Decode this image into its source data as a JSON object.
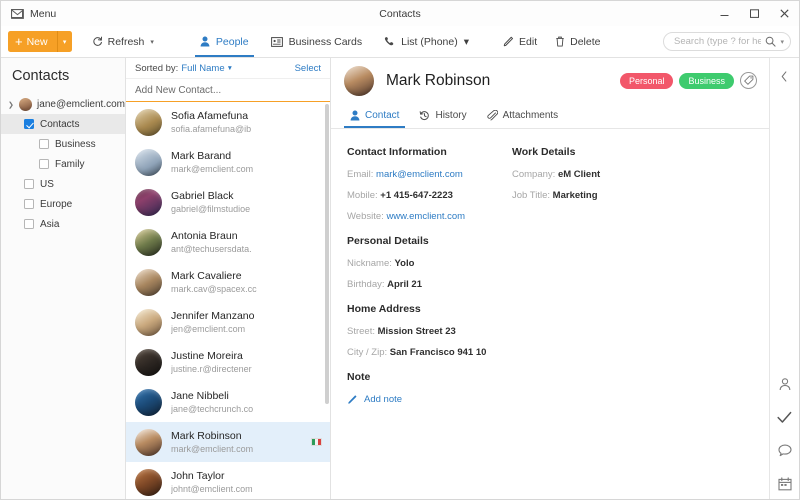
{
  "titlebar": {
    "menu_label": "Menu",
    "menu_icon": "envelope-icon",
    "window_title": "Contacts",
    "minimize_icon": "minimize-icon",
    "maximize_icon": "maximize-icon",
    "close_icon": "close-icon"
  },
  "toolbar": {
    "new_label": "New",
    "new_color": "#f6a026",
    "refresh_label": "Refresh",
    "tabs": [
      {
        "label": "People",
        "icon": "person-icon",
        "active": true
      },
      {
        "label": "Business Cards",
        "icon": "card-icon",
        "active": false
      },
      {
        "label": "List (Phone)",
        "icon": "phone-icon",
        "active": false,
        "has_caret": true
      }
    ],
    "edit_label": "Edit",
    "delete_label": "Delete",
    "accent": "#2e7cc4"
  },
  "search": {
    "placeholder": "Search (type ? for help)",
    "value": "",
    "icon": "search-icon"
  },
  "sidebar": {
    "title": "Contacts",
    "account": "jane@emclient.com",
    "items": [
      {
        "label": "Contacts",
        "checked": true,
        "level": 1,
        "selected": true
      },
      {
        "label": "Business",
        "checked": false,
        "level": 2,
        "selected": false
      },
      {
        "label": "Family",
        "checked": false,
        "level": 2,
        "selected": false
      },
      {
        "label": "US",
        "checked": false,
        "level": 1,
        "selected": false
      },
      {
        "label": "Europe",
        "checked": false,
        "level": 1,
        "selected": false
      },
      {
        "label": "Asia",
        "checked": false,
        "level": 1,
        "selected": false
      }
    ]
  },
  "list": {
    "sort_prefix": "Sorted by:",
    "sort_value": "Full Name",
    "select_label": "Select",
    "add_new_label": "Add New Contact...",
    "contacts": [
      {
        "name": "Sofia Afamefuna",
        "email": "sofia.afamefuna@ib",
        "avatar": "linear-gradient(150deg,#d8c49a 10%,#a9894f 55%,#6b5a33 95%)",
        "selected": false,
        "flag": false
      },
      {
        "name": "Mark Barand",
        "email": "mark@emclient.com",
        "avatar": "linear-gradient(150deg,#ccd8e4 10%,#8fa3b8 60%,#4e5e6e 95%)",
        "selected": false,
        "flag": false
      },
      {
        "name": "Gabriel Black",
        "email": "gabriel@filmstudioe",
        "avatar": "linear-gradient(150deg,#6b2f4d 5%,#8d3f6b 35%,#3a2b55 95%)",
        "selected": false,
        "flag": false
      },
      {
        "name": "Antonia Braun",
        "email": "ant@techusersdata.",
        "avatar": "linear-gradient(150deg,#c9c08a 8%,#6e7a4a 50%,#2f3524 95%)",
        "selected": false,
        "flag": false
      },
      {
        "name": "Mark Cavaliere",
        "email": "mark.cav@spacex.cc",
        "avatar": "linear-gradient(150deg,#e2cdb4 8%,#a8865f 50%,#5b4a38 95%)",
        "selected": false,
        "flag": false
      },
      {
        "name": "Jennifer Manzano",
        "email": "jen@emclient.com",
        "avatar": "linear-gradient(150deg,#efe0c4 8%,#caa97e 50%,#7d6348 95%)",
        "selected": false,
        "flag": false
      },
      {
        "name": "Justine Moreira",
        "email": "justine.r@directener",
        "avatar": "linear-gradient(150deg,#4e4238 8%,#2b2521 55%,#161412 95%)",
        "selected": false,
        "flag": false
      },
      {
        "name": "Jane Nibbeli",
        "email": "jane@techcrunch.co",
        "avatar": "linear-gradient(150deg,#2f6ea8 8%,#1b4a77 50%,#12273d 95%)",
        "selected": false,
        "flag": false
      },
      {
        "name": "Mark Robinson",
        "email": "mark@emclient.com",
        "avatar": "linear-gradient(155deg,#e8d6c4 8%,#b98c62 45%,#5c4031 95%)",
        "selected": true,
        "flag": true
      },
      {
        "name": "John Taylor",
        "email": "johnt@emclient.com",
        "avatar": "linear-gradient(150deg,#b4703e 8%,#7d4726 50%,#3b2315 95%)",
        "selected": false,
        "flag": false
      }
    ],
    "flag_colors": [
      "#2e9c5a",
      "#f2f2f2",
      "#d9413f"
    ]
  },
  "detail": {
    "name": "Mark Robinson",
    "tags": [
      {
        "label": "Personal",
        "color": "#f2576a"
      },
      {
        "label": "Business",
        "color": "#3ecb6e"
      }
    ],
    "add_tag_icon": "tag-plus-icon",
    "collapse_icon": "chevron-left-icon",
    "tabs": [
      {
        "label": "Contact",
        "icon": "person-icon",
        "active": true
      },
      {
        "label": "History",
        "icon": "history-icon",
        "active": false
      },
      {
        "label": "Attachments",
        "icon": "paperclip-icon",
        "active": false
      }
    ],
    "sections": {
      "contact_information": {
        "title": "Contact Information",
        "fields": [
          {
            "label": "Email:",
            "value": "mark@emclient.com",
            "style": "link"
          },
          {
            "label": "Mobile:",
            "value": "+1 415-647-2223",
            "style": "bold"
          },
          {
            "label": "Website:",
            "value": "www.emclient.com",
            "style": "link"
          }
        ]
      },
      "work_details": {
        "title": "Work Details",
        "fields": [
          {
            "label": "Company:",
            "value": "eM Client",
            "style": "bold"
          },
          {
            "label": "Job Title:",
            "value": "Marketing",
            "style": "bold"
          }
        ]
      },
      "personal_details": {
        "title": "Personal Details",
        "fields": [
          {
            "label": "Nickname:",
            "value": "Yolo",
            "style": "bold"
          },
          {
            "label": "Birthday:",
            "value": "April 21",
            "style": "bold"
          }
        ]
      },
      "home_address": {
        "title": "Home Address",
        "fields": [
          {
            "label": "Street:",
            "value": "Mission Street 23",
            "style": "bold"
          },
          {
            "label": "City / Zip:",
            "value": "San Francisco 941 10",
            "style": "bold"
          }
        ]
      },
      "note": {
        "title": "Note",
        "add_label": "Add note",
        "add_icon": "pencil-icon"
      }
    }
  },
  "rail": {
    "icons": [
      {
        "name": "contacts-icon"
      },
      {
        "name": "tasks-check-icon"
      },
      {
        "name": "chat-icon"
      },
      {
        "name": "calendar-icon"
      }
    ]
  }
}
